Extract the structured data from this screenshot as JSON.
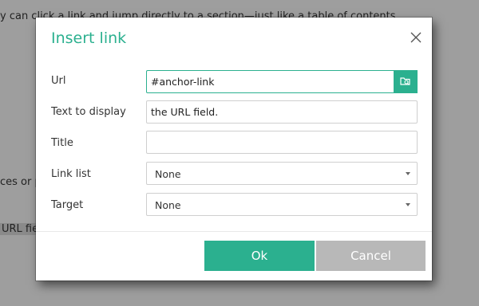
{
  "background": {
    "line1": "y can click a link and jump directly to a section—just like a table of contents.",
    "line2": "ces or p",
    "line3": "URL fiel"
  },
  "dialog": {
    "title": "Insert link",
    "fields": {
      "url_label": "Url",
      "url_value": "#anchor-link",
      "text_label": "Text to display",
      "text_value": "the URL field.",
      "title_label": "Title",
      "title_value": "",
      "link_list_label": "Link list",
      "link_list_value": "None",
      "target_label": "Target",
      "target_value": "None"
    },
    "buttons": {
      "ok": "Ok",
      "cancel": "Cancel"
    }
  },
  "colors": {
    "accent": "#2bb08f",
    "cancel": "#b8b8b8",
    "overlay": "#9e9e9e"
  },
  "icons": {
    "close": "close-icon",
    "browse": "browse-folder-icon",
    "dropdown": "caret-down-icon"
  }
}
